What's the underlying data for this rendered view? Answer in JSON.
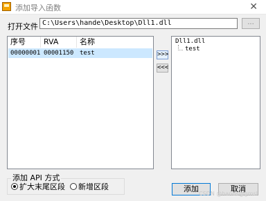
{
  "window": {
    "title": "添加导入函数",
    "close_glyph": "✕"
  },
  "open_file": {
    "label": "打开文件",
    "path": "C:\\Users\\hande\\Desktop\\Dll1.dll",
    "browse_label": "..."
  },
  "table": {
    "columns": [
      "序号",
      "RVA",
      "名称"
    ],
    "rows": [
      {
        "index": "00000001",
        "rva": "00001150",
        "name": "test"
      }
    ]
  },
  "move_buttons": {
    "add": ">>>",
    "remove": "<<<"
  },
  "tree": {
    "root": "Dll1.dll",
    "children": [
      "test"
    ]
  },
  "add_api_mode": {
    "label": "添加 API 方式",
    "options": [
      "扩大末尾区段",
      "新增区段"
    ],
    "selected_index": 0
  },
  "buttons": {
    "add": "添加",
    "cancel": "取消"
  },
  "watermark": "CSDN @hands@gmsl",
  "colors": {
    "selected_row": "#cce8ff",
    "app_icon": "#f4a300",
    "default_button_border": "#0078d7"
  },
  "icons": {
    "app": "app-icon",
    "close": "close-icon",
    "tree_line": "tree-connector-icon"
  }
}
